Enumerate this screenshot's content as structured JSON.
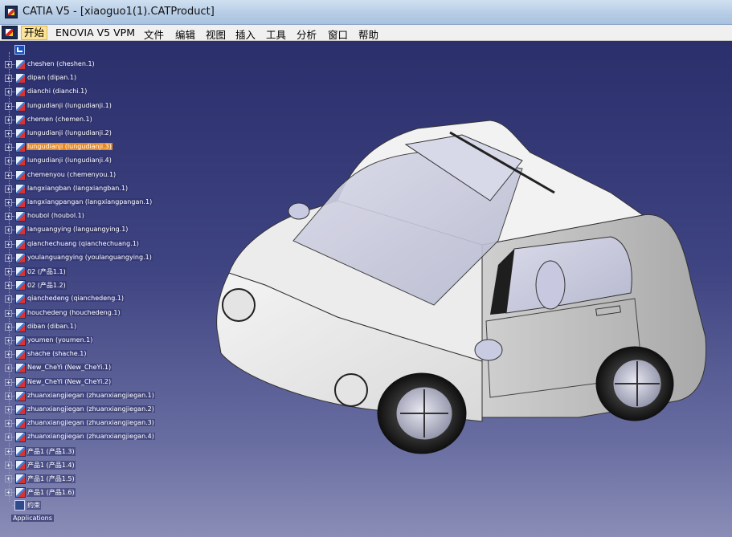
{
  "window": {
    "title": "CATIA V5 - [xiaoguo1(1).CATProduct]"
  },
  "menu": {
    "items": [
      {
        "name": "menu-start",
        "label": "开始",
        "active": true
      },
      {
        "name": "menu-enovia",
        "label": "ENOVIA V5 VPM"
      },
      {
        "name": "menu-file",
        "label": "文件"
      },
      {
        "name": "menu-edit",
        "label": "编辑"
      },
      {
        "name": "menu-view",
        "label": "视图"
      },
      {
        "name": "menu-insert",
        "label": "插入"
      },
      {
        "name": "menu-tools",
        "label": "工具"
      },
      {
        "name": "menu-analysis",
        "label": "分析"
      },
      {
        "name": "menu-window",
        "label": "窗口"
      },
      {
        "name": "menu-help",
        "label": "帮助"
      }
    ]
  },
  "tree": {
    "nodes": [
      {
        "label": "cheshen (cheshen.1)"
      },
      {
        "label": "dipan (dipan.1)"
      },
      {
        "label": "dianchi (dianchi.1)"
      },
      {
        "label": "lungudianji (lungudianji.1)"
      },
      {
        "label": "chemen (chemen.1)"
      },
      {
        "label": "lungudianji (lungudianji.2)"
      },
      {
        "label": "lungudianji (lungudianji.3)",
        "selected": true
      },
      {
        "label": "lungudianji (lungudianji.4)"
      },
      {
        "label": "chemenyou (chemenyou.1)"
      },
      {
        "label": "langxiangban (langxiangban.1)"
      },
      {
        "label": "langxiangpangan (langxiangpangan.1)"
      },
      {
        "label": "houbol (houbol.1)"
      },
      {
        "label": "languangying (languangying.1)"
      },
      {
        "label": "qianchechuang (qianchechuang.1)"
      },
      {
        "label": "youlanguangying (youlanguangying.1)"
      },
      {
        "label": "02 (产品1.1)"
      },
      {
        "label": "02 (产品1.2)"
      },
      {
        "label": "qianchedeng (qianchedeng.1)"
      },
      {
        "label": "houchedeng (houchedeng.1)"
      },
      {
        "label": "diban (diban.1)"
      },
      {
        "label": "youmen (youmen.1)"
      },
      {
        "label": "shache (shache.1)"
      },
      {
        "label": "New_CheYi (New_CheYi.1)"
      },
      {
        "label": "New_CheYi (New_CheYi.2)"
      },
      {
        "label": "zhuanxiangjiegan (zhuanxiangjiegan.1)"
      },
      {
        "label": "zhuanxiangjiegan (zhuanxiangjiegan.2)"
      },
      {
        "label": "zhuanxiangjiegan (zhuanxiangjiegan.3)"
      },
      {
        "label": "zhuanxiangjiegan (zhuanxiangjiegan.4)"
      },
      {
        "label": "产品1 (产品1.3)"
      },
      {
        "label": "产品1 (产品1.4)"
      },
      {
        "label": "产品1 (产品1.5)"
      },
      {
        "label": "产品1 (产品1.6)"
      }
    ],
    "constraints_label": "约束",
    "applications_label": "Applications"
  },
  "colors": {
    "selection": "#e9871c",
    "viewport_top": "#2b2f6c",
    "viewport_bottom": "#8a8db6"
  }
}
